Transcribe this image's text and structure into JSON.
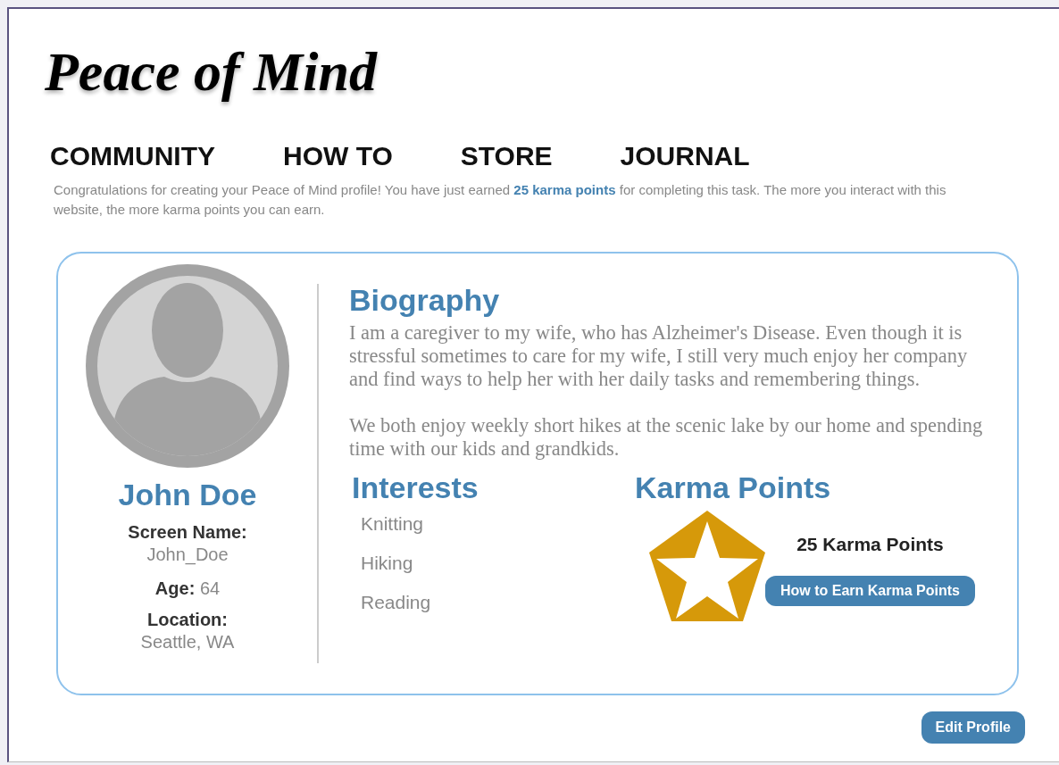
{
  "logo": "Peace of Mind",
  "nav": [
    "COMMUNITY",
    "HOW TO",
    "STORE",
    "JOURNAL"
  ],
  "intro": "Congratulations for creating your Peace of Mind profile! You have just earned **25 karma points** for completing this task. The more you interact with this website, the more karma points you can earn.",
  "profile": {
    "name": "John Doe",
    "details": [
      {
        "label": "Screen Name:",
        "value": "John_Doe",
        "inline": false
      },
      {
        "label": "Age:",
        "value": "64",
        "inline": true
      },
      {
        "label": "Location:",
        "value": "Seattle, WA",
        "inline": false
      }
    ]
  },
  "biography": {
    "heading": "Biography",
    "paragraphs": [
      "I am a caregiver to my wife, who has Alzheimer's Disease. Even though it is stressful sometimes to care for my wife, I still very much enjoy her company and find ways to help her with her daily tasks and remembering things.",
      "We both enjoy weekly short hikes at the scenic lake by our home and spending time with our kids and grandkids."
    ]
  },
  "interests": {
    "heading": "Interests",
    "items": [
      "Knitting",
      "Hiking",
      "Reading"
    ]
  },
  "karma": {
    "heading": "Karma Points",
    "total": "25 Karma Points",
    "button": "How to Earn Karma Points"
  },
  "edit_button": "Edit Profile"
}
